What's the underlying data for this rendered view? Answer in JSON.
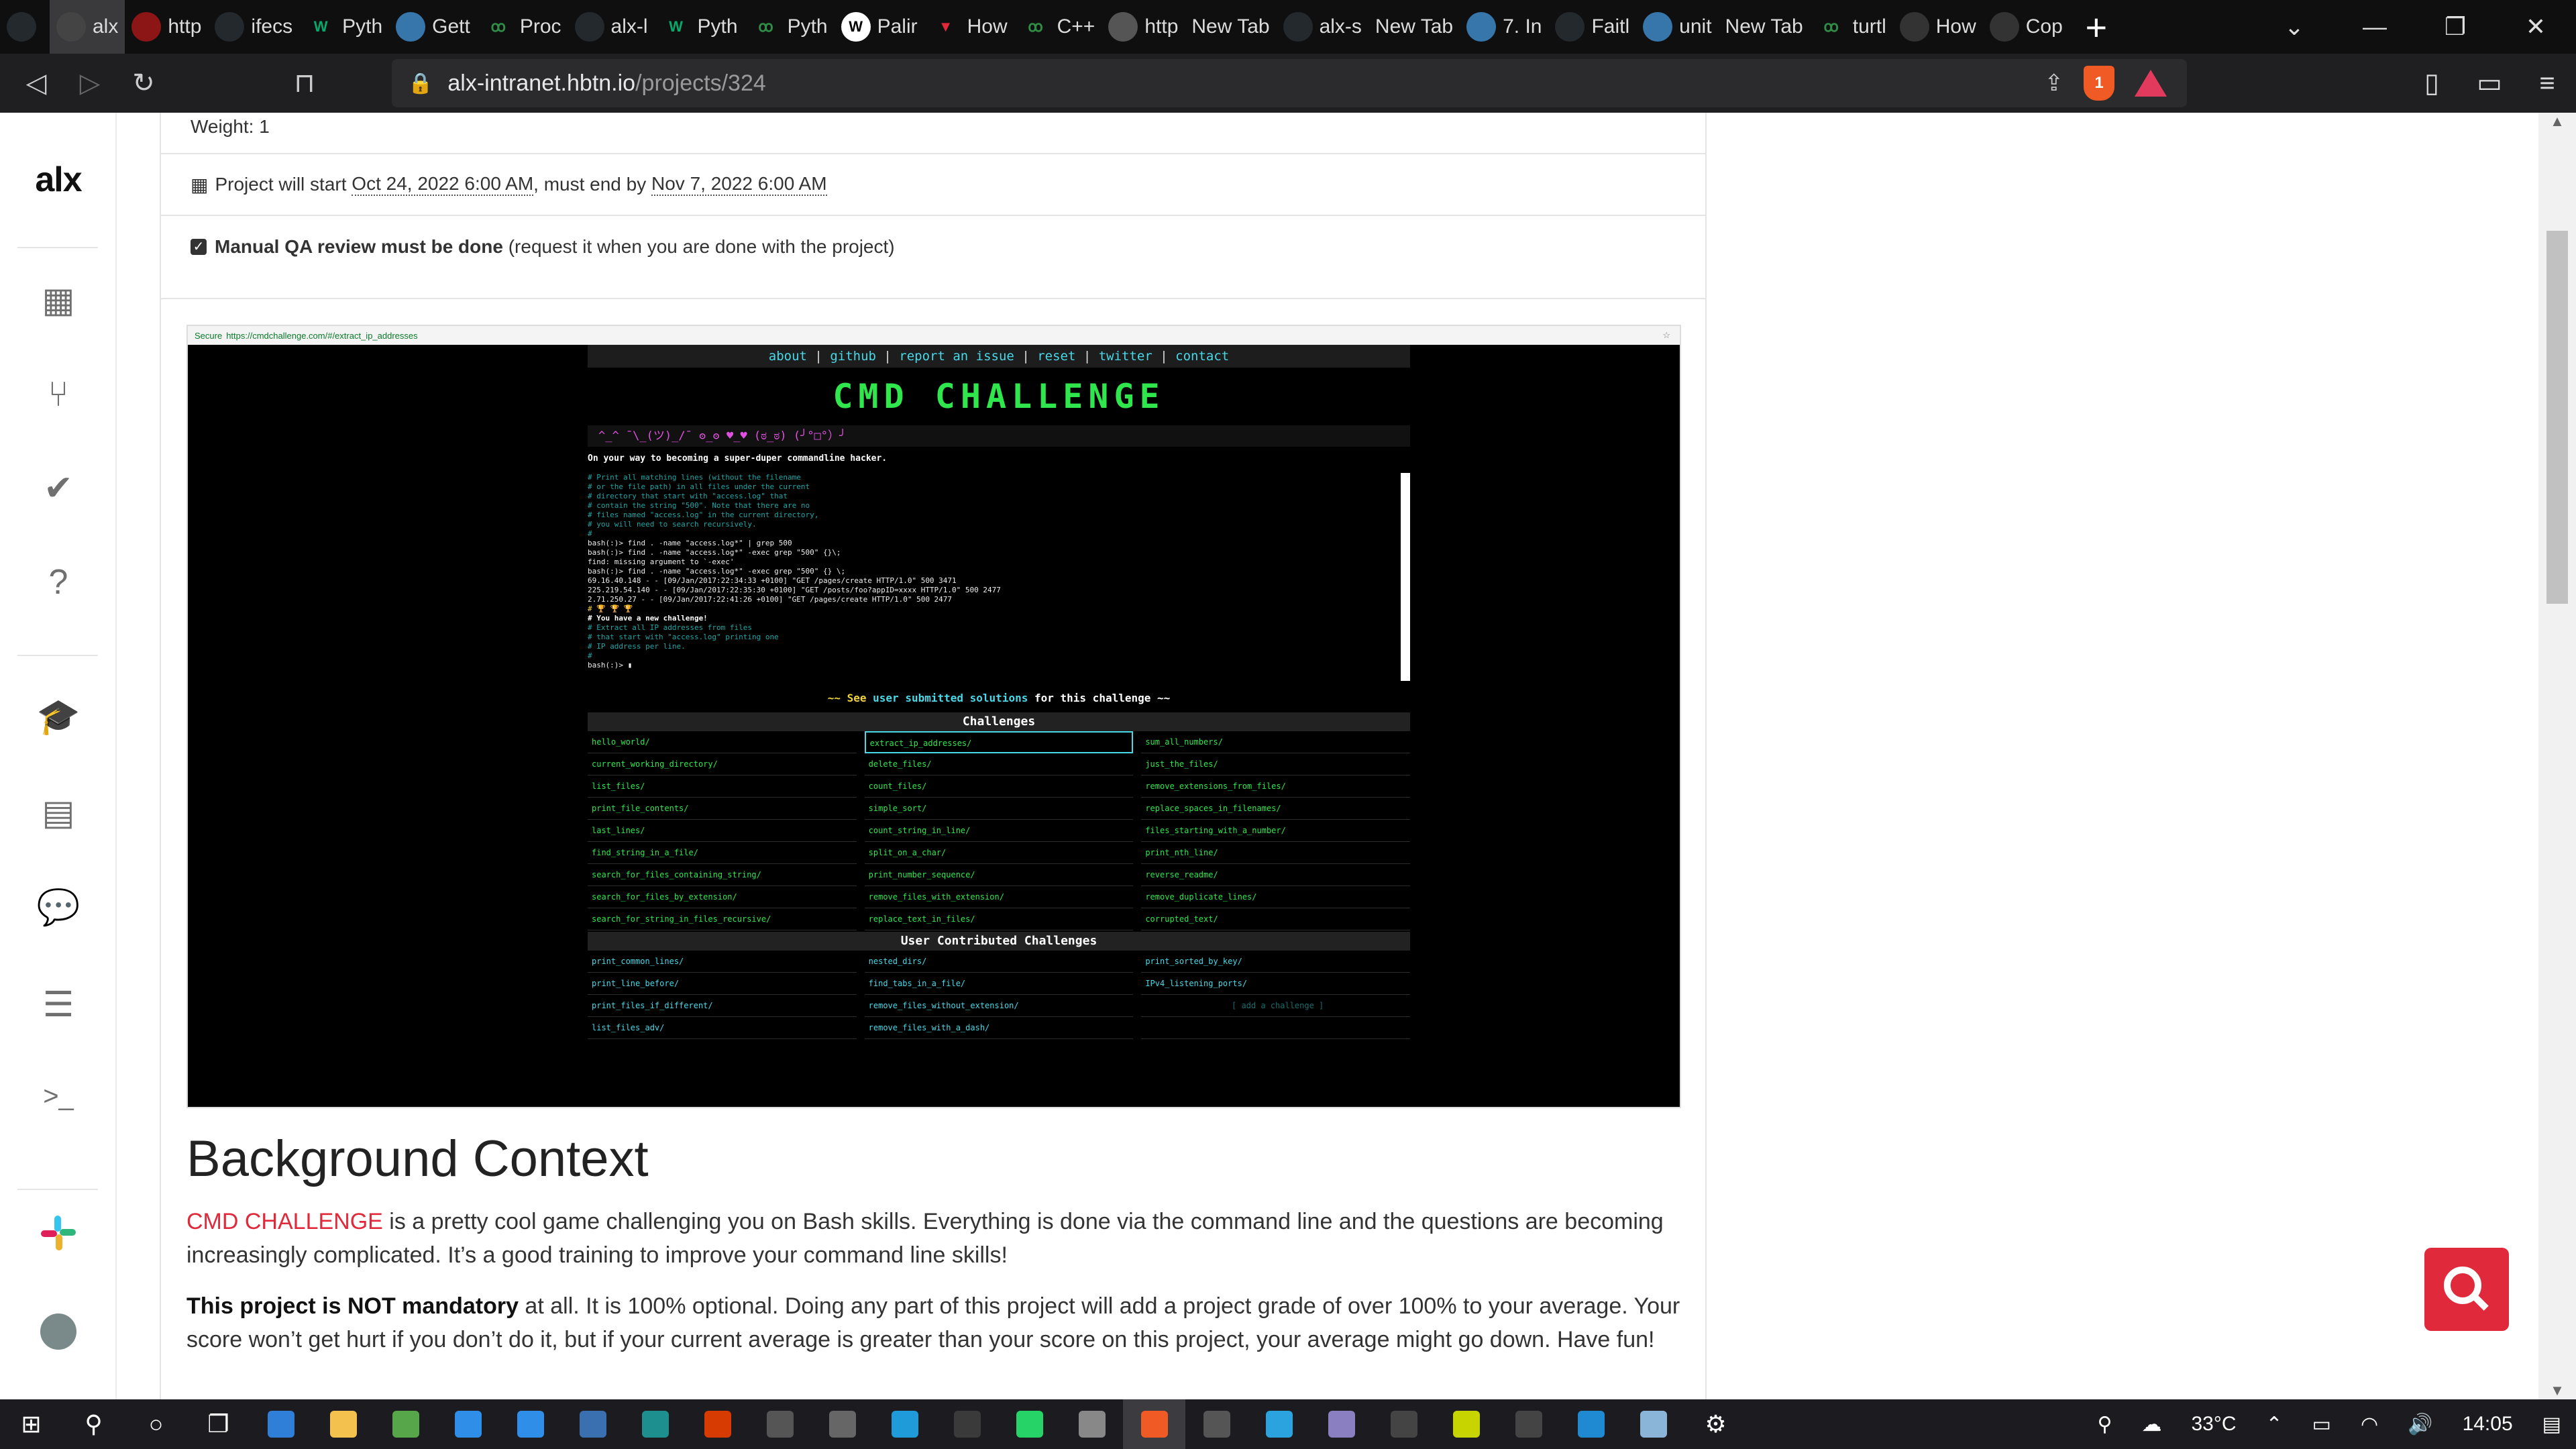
{
  "browser": {
    "tabs": [
      {
        "label": "",
        "icon": "github-icon",
        "color": "#24292e"
      },
      {
        "label": "alx",
        "icon": "alx-icon",
        "color": "#444",
        "active": true
      },
      {
        "label": "http",
        "icon": "stanford-icon",
        "color": "#8c1515"
      },
      {
        "label": "ifecs",
        "icon": "github-icon",
        "color": "#24292e"
      },
      {
        "label": "Pyth",
        "icon": "w3-icon",
        "color": "#04aa6d"
      },
      {
        "label": "Gett",
        "icon": "python-icon",
        "color": "#3776ab"
      },
      {
        "label": "Proc",
        "icon": "geeks-icon",
        "color": "#2f8d46"
      },
      {
        "label": "alx-l",
        "icon": "github-icon",
        "color": "#24292e"
      },
      {
        "label": "Pyth",
        "icon": "w3-icon",
        "color": "#04aa6d"
      },
      {
        "label": "Pyth",
        "icon": "geeks-icon",
        "color": "#2f8d46"
      },
      {
        "label": "Palir",
        "icon": "wikipedia-icon",
        "color": "#fff"
      },
      {
        "label": "How",
        "icon": "vivaldi-icon",
        "color": "#e0293a"
      },
      {
        "label": "C++",
        "icon": "geeks-icon",
        "color": "#2f8d46"
      },
      {
        "label": "http",
        "icon": "globe-icon",
        "color": "#555"
      },
      {
        "label": "New Tab",
        "icon": "",
        "color": ""
      },
      {
        "label": "alx-s",
        "icon": "github-icon",
        "color": "#24292e"
      },
      {
        "label": "New Tab",
        "icon": "",
        "color": ""
      },
      {
        "label": "7. In",
        "icon": "python-icon",
        "color": "#3776ab"
      },
      {
        "label": "Faitl",
        "icon": "github-icon",
        "color": "#24292e"
      },
      {
        "label": "unit",
        "icon": "python-icon",
        "color": "#3776ab"
      },
      {
        "label": "New Tab",
        "icon": "",
        "color": ""
      },
      {
        "label": "turtl",
        "icon": "geeks-icon",
        "color": "#2f8d46"
      },
      {
        "label": "How",
        "icon": "loading-icon",
        "color": "#333"
      },
      {
        "label": "Cop",
        "icon": "loading-icon",
        "color": "#333"
      }
    ],
    "url_host": "alx-intranet.hbtn.io",
    "url_path": "/projects/324",
    "brave_badge": "1"
  },
  "sidebar": {
    "logo": "alx",
    "items": [
      {
        "name": "calendar-icon",
        "glyph": "▦"
      },
      {
        "name": "branch-icon",
        "glyph": "⑂"
      },
      {
        "name": "check-icon",
        "glyph": "✔"
      },
      {
        "name": "help-icon",
        "glyph": "?"
      },
      {
        "name": "graduation-cap-icon",
        "glyph": "🎓"
      },
      {
        "name": "document-icon",
        "glyph": "▤"
      },
      {
        "name": "chat-icon",
        "glyph": "💬"
      },
      {
        "name": "server-icon",
        "glyph": "☰"
      },
      {
        "name": "terminal-icon",
        "glyph": ">_"
      }
    ]
  },
  "project": {
    "weight_label": "Weight: 1",
    "start_prefix": "Project will start",
    "start_date": "Oct 24, 2022 6:00 AM",
    "end_prefix": ", must end by",
    "end_date": "Nov 7, 2022 6:00 AM",
    "qa_bold": "Manual QA review must be done",
    "qa_note": "(request it when you are done with the project)"
  },
  "embedded_screenshot": {
    "secure_label": "Secure",
    "url": "https://cmdchallenge.com/#/extract_ip_addresses",
    "nav": [
      "about",
      "github",
      "report an issue",
      "reset",
      "twitter",
      "contact"
    ],
    "banner": "CMD CHALLENGE",
    "faces": "^_^   ¯\\_(ツ)_/¯   ʘ_ʘ   ♥_♥   (ಠ_ಠ)   (╯°□°）╯",
    "tagline": "On your way to becoming a super-duper commandline hacker.",
    "terminal_lines": [
      {
        "cls": "cm",
        "text": "# Print all matching lines (without the filename"
      },
      {
        "cls": "cm",
        "text": "# or the file path) in all files under the current"
      },
      {
        "cls": "cm",
        "text": "# directory that start with \"access.log\" that"
      },
      {
        "cls": "cm",
        "text": "# contain the string \"500\". Note that there are no"
      },
      {
        "cls": "cm",
        "text": "# files named \"access.log\" in the current directory,"
      },
      {
        "cls": "cm",
        "text": "# you will need to search recursively."
      },
      {
        "cls": "cm",
        "text": "#"
      },
      {
        "cls": "w",
        "text": "bash(:)> find . -name \"access.log*\" | grep 500"
      },
      {
        "cls": "w",
        "text": "bash(:)> find . -name \"access.log*\" -exec grep \"500\" {}\\;"
      },
      {
        "cls": "w",
        "text": "find: missing argument to `-exec'"
      },
      {
        "cls": "w",
        "text": "bash(:)> find . -name \"access.log*\" -exec grep \"500\" {} \\;"
      },
      {
        "cls": "w",
        "text": "69.16.40.148 - - [09/Jan/2017:22:34:33 +0100] \"GET /pages/create HTTP/1.0\" 500 3471"
      },
      {
        "cls": "w",
        "text": "225.219.54.140 - - [09/Jan/2017:22:35:30 +0100] \"GET /posts/foo?appID=xxxx HTTP/1.0\" 500 2477"
      },
      {
        "cls": "w",
        "text": "2.71.250.27 - - [09/Jan/2017:22:41:26 +0100] \"GET /pages/create HTTP/1.0\" 500 2477"
      },
      {
        "cls": "y",
        "text": "# 🏆 🏆 🏆"
      },
      {
        "cls": "wb",
        "text": "# You have a new challenge!"
      },
      {
        "cls": "cm",
        "text": "# Extract all IP addresses from files"
      },
      {
        "cls": "cm",
        "text": "# that start with \"access.log\" printing one"
      },
      {
        "cls": "cm",
        "text": "# IP address per line."
      },
      {
        "cls": "cm",
        "text": "#"
      },
      {
        "cls": "w",
        "text": "bash(:)> ▮"
      }
    ],
    "see_prefix": "~~ See",
    "see_link": "user submitted solutions",
    "see_suffix": "for this challenge ~~",
    "challenges_title": "Challenges",
    "challenges": [
      "hello_world/",
      "extract_ip_addresses/",
      "sum_all_numbers/",
      "current_working_directory/",
      "delete_files/",
      "just_the_files/",
      "list_files/",
      "count_files/",
      "remove_extensions_from_files/",
      "print_file_contents/",
      "simple_sort/",
      "replace_spaces_in_filenames/",
      "last_lines/",
      "count_string_in_line/",
      "files_starting_with_a_number/",
      "find_string_in_a_file/",
      "split_on_a_char/",
      "print_nth_line/",
      "search_for_files_containing_string/",
      "print_number_sequence/",
      "reverse_readme/",
      "search_for_files_by_extension/",
      "remove_files_with_extension/",
      "remove_duplicate_lines/",
      "search_for_string_in_files_recursive/",
      "replace_text_in_files/",
      "corrupted_text/"
    ],
    "user_title": "User Contributed Challenges",
    "user_challenges": [
      "print_common_lines/",
      "nested_dirs/",
      "print_sorted_by_key/",
      "print_line_before/",
      "find_tabs_in_a_file/",
      "IPv4_listening_ports/",
      "print_files_if_different/",
      "remove_files_without_extension/",
      "[ add a challenge ]",
      "list_files_adv/",
      "remove_files_with_a_dash/",
      ""
    ]
  },
  "article": {
    "heading": "Background Context",
    "p1_link": "CMD CHALLENGE",
    "p1_text": " is a pretty cool game challenging you on Bash skills. Everything is done via the command line and the questions are becoming increasingly complicated. It’s a good training to improve your command line skills!",
    "p2_bold": "This project is NOT mandatory",
    "p2_text": " at all. It is 100% optional. Doing any part of this project will add a project grade of over 100% to your average. Your score won’t get hurt if you don’t do it, but if your current average is greater than your score on this project, your average might go down. Have fun!"
  },
  "taskbar": {
    "weather": "33°C",
    "time": "14:05"
  }
}
